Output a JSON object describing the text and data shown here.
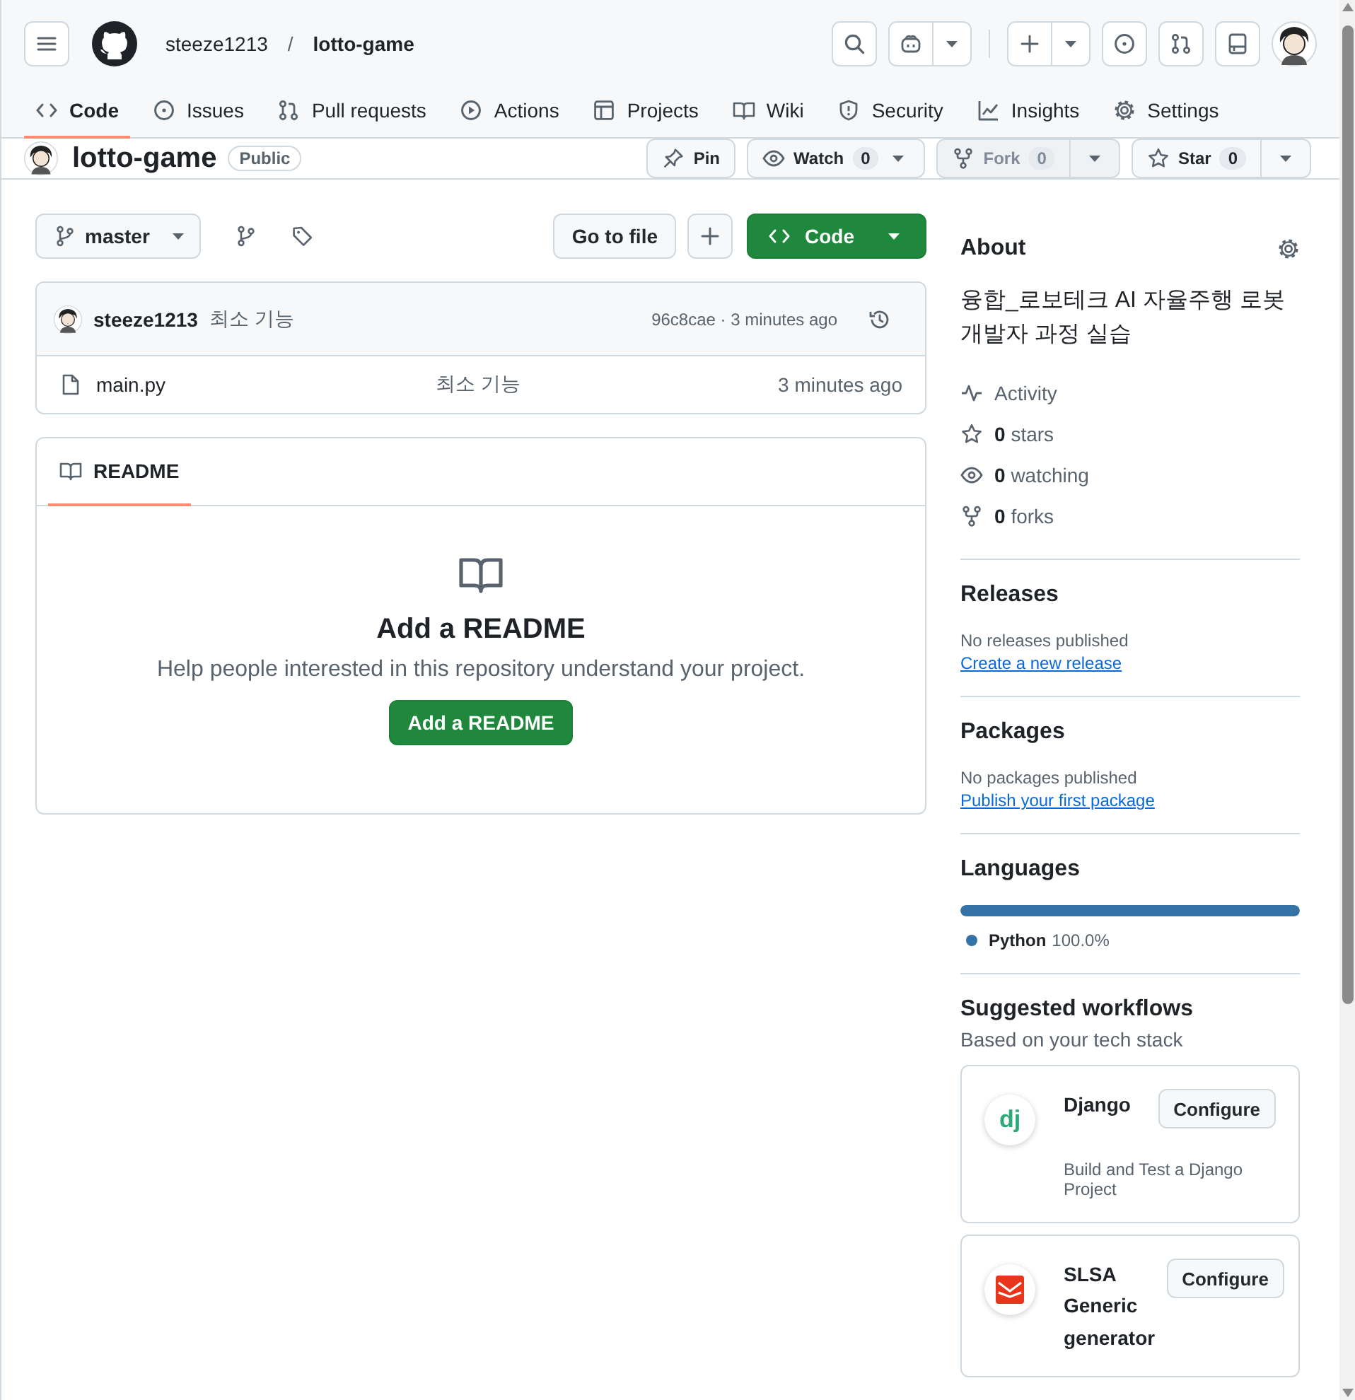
{
  "header": {
    "owner": "steeze1213",
    "separator": "/",
    "repo": "lotto-game"
  },
  "tabs": [
    {
      "label": "Code",
      "selected": true
    },
    {
      "label": "Issues",
      "selected": false
    },
    {
      "label": "Pull requests",
      "selected": false
    },
    {
      "label": "Actions",
      "selected": false
    },
    {
      "label": "Projects",
      "selected": false
    },
    {
      "label": "Wiki",
      "selected": false
    },
    {
      "label": "Security",
      "selected": false
    },
    {
      "label": "Insights",
      "selected": false
    },
    {
      "label": "Settings",
      "selected": false
    }
  ],
  "repo": {
    "name": "lotto-game",
    "visibility": "Public"
  },
  "repo_actions": [
    {
      "kind": "plain",
      "label": "Pin",
      "disabled": false
    },
    {
      "kind": "menu",
      "label": "Watch",
      "count": "0",
      "disabled": false
    },
    {
      "kind": "split",
      "label": "Fork",
      "count": "0",
      "disabled": true
    },
    {
      "kind": "split",
      "label": "Star",
      "count": "0",
      "disabled": false
    }
  ],
  "toolbar": {
    "branch": "master",
    "go_to_file": "Go to file",
    "code": "Code"
  },
  "commit": {
    "author": "steeze1213",
    "message": "최소 기능",
    "meta": "96c8cae · 3 minutes ago"
  },
  "files": [
    {
      "name": "main.py",
      "message": "최소 기능",
      "time": "3 minutes ago"
    }
  ],
  "readme": {
    "tab": "README",
    "title": "Add a README",
    "text": "Help people interested in this repository understand your project.",
    "button": "Add a README"
  },
  "sidebar": {
    "about": {
      "title": "About",
      "description": "융합_로보테크 AI 자율주행 로봇 개발자 과정 실습",
      "links": [
        {
          "label": "Activity"
        },
        {
          "count": "0",
          "label": "stars"
        },
        {
          "count": "0",
          "label": "watching"
        },
        {
          "count": "0",
          "label": "forks"
        }
      ]
    },
    "releases": {
      "title": "Releases",
      "text": "No releases published",
      "link": "Create a new release"
    },
    "packages": {
      "title": "Packages",
      "text": "No packages published",
      "link": "Publish your first package"
    },
    "languages": {
      "title": "Languages",
      "items": [
        {
          "name": "Python",
          "percent": "100.0%",
          "color": "#3572a5",
          "level": 1
        }
      ]
    },
    "workflows": {
      "title": "Suggested workflows",
      "subtitle": "Based on your tech stack",
      "items": [
        {
          "kind": "django",
          "logo": "dj",
          "name": "Django",
          "button": "Configure",
          "description": "Build and Test a Django Project"
        },
        {
          "kind": "slsa",
          "name": "SLSA Generic generator",
          "button": "Configure"
        }
      ]
    }
  }
}
